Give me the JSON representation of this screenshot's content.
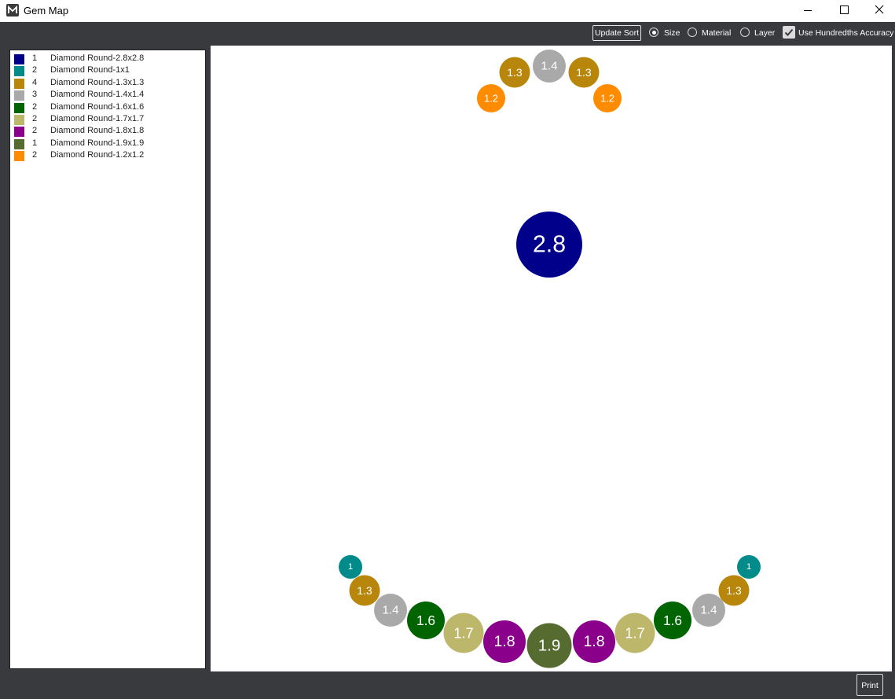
{
  "window": {
    "title": "Gem Map"
  },
  "toolbar": {
    "update_sort_label": "Update Sort",
    "sort_options": [
      {
        "label": "Size",
        "selected": true
      },
      {
        "label": "Material",
        "selected": false
      },
      {
        "label": "Layer",
        "selected": false
      }
    ],
    "accuracy": {
      "label": "Use Hundredths Accuracy",
      "checked": true
    }
  },
  "legend": [
    {
      "count": "1",
      "name": "Diamond Round-2.8x2.8",
      "color": "#00008b"
    },
    {
      "count": "2",
      "name": "Diamond Round-1x1",
      "color": "#008b8b"
    },
    {
      "count": "4",
      "name": "Diamond Round-1.3x1.3",
      "color": "#b8860b"
    },
    {
      "count": "3",
      "name": "Diamond Round-1.4x1.4",
      "color": "#a9a9a9"
    },
    {
      "count": "2",
      "name": "Diamond Round-1.6x1.6",
      "color": "#006400"
    },
    {
      "count": "2",
      "name": "Diamond Round-1.7x1.7",
      "color": "#bdb76b"
    },
    {
      "count": "2",
      "name": "Diamond Round-1.8x1.8",
      "color": "#8b008b"
    },
    {
      "count": "1",
      "name": "Diamond Round-1.9x1.9",
      "color": "#556b2f"
    },
    {
      "count": "2",
      "name": "Diamond Round-1.2x1.2",
      "color": "#ff8c00"
    }
  ],
  "gems": [
    {
      "label": "1.4",
      "size": 1.4,
      "color": "#a9a9a9"
    },
    {
      "label": "1.3",
      "size": 1.3,
      "color": "#b8860b"
    },
    {
      "label": "1.3",
      "size": 1.3,
      "color": "#b8860b"
    },
    {
      "label": "1.2",
      "size": 1.2,
      "color": "#ff8c00"
    },
    {
      "label": "1.2",
      "size": 1.2,
      "color": "#ff8c00"
    },
    {
      "label": "2.8",
      "size": 2.8,
      "color": "#00008b"
    },
    {
      "label": "1",
      "size": 1.0,
      "color": "#008b8b"
    },
    {
      "label": "1",
      "size": 1.0,
      "color": "#008b8b"
    },
    {
      "label": "1.3",
      "size": 1.3,
      "color": "#b8860b"
    },
    {
      "label": "1.3",
      "size": 1.3,
      "color": "#b8860b"
    },
    {
      "label": "1.4",
      "size": 1.4,
      "color": "#a9a9a9"
    },
    {
      "label": "1.4",
      "size": 1.4,
      "color": "#a9a9a9"
    },
    {
      "label": "1.6",
      "size": 1.6,
      "color": "#006400"
    },
    {
      "label": "1.6",
      "size": 1.6,
      "color": "#006400"
    },
    {
      "label": "1.7",
      "size": 1.7,
      "color": "#bdb76b"
    },
    {
      "label": "1.7",
      "size": 1.7,
      "color": "#bdb76b"
    },
    {
      "label": "1.8",
      "size": 1.8,
      "color": "#8b008b"
    },
    {
      "label": "1.8",
      "size": 1.8,
      "color": "#8b008b"
    },
    {
      "label": "1.9",
      "size": 1.9,
      "color": "#556b2f"
    }
  ],
  "footer": {
    "print_label": "Print"
  }
}
